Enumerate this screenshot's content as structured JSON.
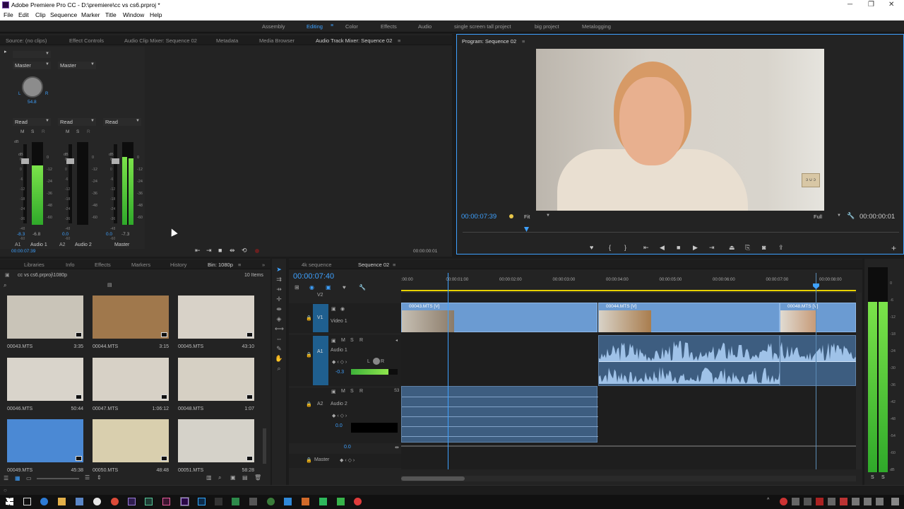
{
  "window": {
    "title": "Adobe Premiere Pro CC - D:\\premiere\\cc vs cs6.prproj *",
    "controls": [
      "─",
      "❐",
      "✕"
    ]
  },
  "menu": [
    "File",
    "Edit",
    "Clip",
    "Sequence",
    "Marker",
    "Title",
    "Window",
    "Help"
  ],
  "workspaces": [
    "Assembly",
    "Editing",
    "Color",
    "Effects",
    "Audio",
    "single screen tall project",
    "big project",
    "Metalogging"
  ],
  "source_tabs": [
    "Source: (no clips)",
    "Effect Controls",
    "Audio Clip Mixer: Sequence 02",
    "Metadata",
    "Media Browser",
    "Audio Track Mixer: Sequence 02"
  ],
  "mixer": {
    "routing": [
      "Master",
      "Master"
    ],
    "pan_value": "54.8",
    "pan_l": "L",
    "pan_r": "R",
    "automation": [
      "Read",
      "Read",
      "Read"
    ],
    "msr": [
      "M",
      "S",
      "R"
    ],
    "db_label": "dB",
    "fader_scale": [
      "6",
      "3",
      "0",
      "-3",
      "-6",
      "-9",
      "-12",
      "-15",
      "-18",
      "-21",
      "-24",
      "-30",
      "-36",
      "-42",
      "-48",
      "-54",
      "-60"
    ],
    "meter_scale": [
      "0",
      "-12",
      "-24",
      "-36",
      "-48",
      "-60",
      "dB"
    ],
    "values": [
      {
        "vol": "-8.3",
        "peak": "-6.8"
      },
      {
        "vol": "0.0",
        "peak": ""
      },
      {
        "vol": "0.0",
        "peak": "-7.3"
      }
    ],
    "levels": [
      0.72,
      0.0,
      0.82
    ],
    "track_nums": [
      "A1",
      "A2"
    ],
    "track_names": [
      "Audio 1",
      "Audio 2",
      "Master"
    ],
    "timecode_left": "00:00:07:39",
    "timecode_right": "00:00:00:01"
  },
  "program": {
    "tab": "Program: Sequence 02",
    "timecode": "00:00:07:39",
    "fit": "Fit",
    "quality": "Full",
    "duration": "00:00:00:01",
    "wall_sign": "ɔ ∪ ɔ"
  },
  "project": {
    "tabs": [
      "Libraries",
      "Info",
      "Effects",
      "Markers",
      "History",
      "Bin: 1080p"
    ],
    "path": "cc vs cs6.prproj\\1080p",
    "count": "10 Items",
    "clips": [
      {
        "name": "00043.MTS",
        "dur": "3:35",
        "color": "#c9c4b8"
      },
      {
        "name": "00044.MTS",
        "dur": "3:15",
        "color": "#a0784c"
      },
      {
        "name": "00045.MTS",
        "dur": "43:10",
        "color": "#d8d2c8"
      },
      {
        "name": "00046.MTS",
        "dur": "50:44",
        "color": "#d9d4cb"
      },
      {
        "name": "00047.MTS",
        "dur": "1:06:12",
        "color": "#d7d1c6"
      },
      {
        "name": "00048.MTS",
        "dur": "1:07",
        "color": "#d6d0c4"
      },
      {
        "name": "00049.MTS",
        "dur": "45:38",
        "color": "#4b89d4"
      },
      {
        "name": "00050.MTS",
        "dur": "48:48",
        "color": "#d9cfae"
      },
      {
        "name": "00051.MTS",
        "dur": "58:28",
        "color": "#d5d2c9"
      }
    ]
  },
  "timeline": {
    "tabs": [
      "4k sequence",
      "Sequence 02"
    ],
    "timecode": "00:00:07:40",
    "ruler": [
      ":00:00",
      "00:00:01:00",
      "00:00:02:00",
      "00:00:03:00",
      "00:00:04:00",
      "00:00:05:00",
      "00:00:06:00",
      "00:00:07:00",
      "00:00:08:00"
    ],
    "tracks": {
      "v2": "V2",
      "v1": "V1",
      "video1": "Video 1",
      "a1": "A1",
      "audio1": "Audio 1",
      "a1_vol": "-0.3",
      "a2": "A2",
      "audio2": "Audio 2",
      "a2_vol": "0.0",
      "master": "Master",
      "master_vol": "0.0",
      "lr_l": "L",
      "lr_r": "R",
      "s3": "S3"
    },
    "clips": [
      "00043.MTS [V]",
      "00044.MTS [V]",
      "00048.MTS [V]"
    ],
    "master_meter_scale": [
      "0",
      "-6",
      "-12",
      "-18",
      "-24",
      "-30",
      "-36",
      "-42",
      "-48",
      "-54",
      "-60",
      "dB"
    ],
    "master_bottom": [
      "S",
      "S"
    ]
  },
  "colors": {
    "accent": "#3ea1ff",
    "video_clip": "#6b9bd2",
    "audio_clip": "#3d5d80",
    "playhead": "#3ea1ff"
  }
}
